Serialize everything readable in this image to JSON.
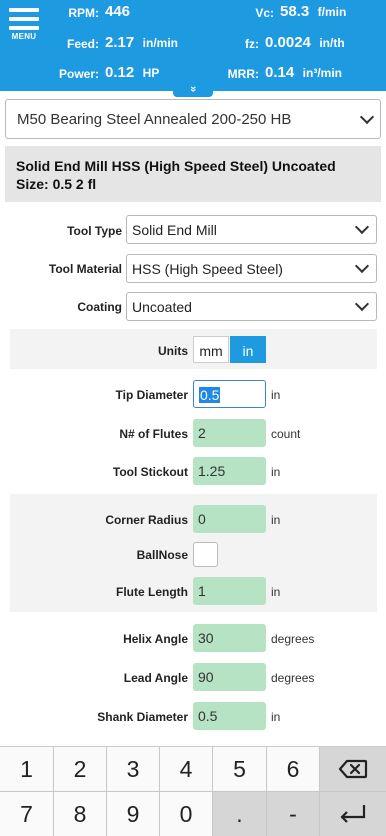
{
  "header": {
    "menu_label": "MENU",
    "stats": [
      {
        "label": "RPM:",
        "value": "446",
        "unit": ""
      },
      {
        "label": "Vc:",
        "value": "58.3",
        "unit": "f/min"
      },
      {
        "label": "Feed:",
        "value": "2.17",
        "unit": "in/min"
      },
      {
        "label": "fz:",
        "value": "0.0024",
        "unit": "in/th"
      },
      {
        "label": "Power:",
        "value": "0.12",
        "unit": "HP"
      },
      {
        "label": "MRR:",
        "value": "0.14",
        "unit": "in³/min"
      }
    ],
    "expand_icon": "»"
  },
  "material": {
    "value": "M50 Bearing Steel Annealed 200-250 HB"
  },
  "summary": {
    "line1": "Solid End Mill HSS (High Speed Steel) Uncoated",
    "line2": "Size: 0.5 2 fl"
  },
  "tool": {
    "type_label": "Tool Type",
    "type_value": "Solid End Mill",
    "material_label": "Tool Material",
    "material_value": "HSS (High Speed Steel)",
    "coating_label": "Coating",
    "coating_value": "Uncoated"
  },
  "units": {
    "label": "Units",
    "options": [
      "mm",
      "in"
    ],
    "selected": "in"
  },
  "fields": {
    "tip_diameter": {
      "label": "Tip Diameter",
      "value": "0.5",
      "unit": "in"
    },
    "flutes": {
      "label": "N# of Flutes",
      "value": "2",
      "unit": "count"
    },
    "stickout": {
      "label": "Tool Stickout",
      "value": "1.25",
      "unit": "in"
    },
    "corner_radius": {
      "label": "Corner Radius",
      "value": "0",
      "unit": "in"
    },
    "ballnose": {
      "label": "BallNose",
      "checked": false
    },
    "flute_length": {
      "label": "Flute Length",
      "value": "1",
      "unit": "in"
    },
    "helix_angle": {
      "label": "Helix Angle",
      "value": "30",
      "unit": "degrees"
    },
    "lead_angle": {
      "label": "Lead Angle",
      "value": "90",
      "unit": "degrees"
    },
    "shank_diameter": {
      "label": "Shank Diameter",
      "value": "0.5",
      "unit": "in"
    }
  },
  "keypad": {
    "row1": [
      "1",
      "2",
      "3",
      "4",
      "5",
      "6"
    ],
    "row2": [
      "7",
      "8",
      "9",
      "0",
      ".",
      "-"
    ],
    "backspace_icon": "backspace-icon",
    "enter_icon": "enter-icon"
  },
  "colors": {
    "accent": "#1e9ae0",
    "field_bg": "#b5e3c3",
    "summary_bg": "#e5e5e5"
  }
}
